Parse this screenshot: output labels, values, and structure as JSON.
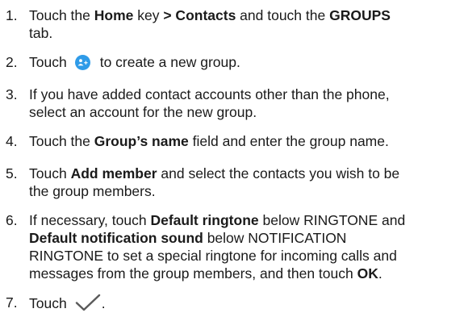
{
  "steps": [
    {
      "number": "1.",
      "lines": [
        {
          "parts": [
            {
              "t": "Touch the "
            },
            {
              "t": "Home",
              "b": true
            },
            {
              "t": " key "
            },
            {
              "t": "> Contacts",
              "b": true
            },
            {
              "t": " and touch the "
            },
            {
              "t": "GROUPS",
              "b": true
            }
          ]
        },
        {
          "parts": [
            {
              "t": "tab."
            }
          ]
        }
      ]
    },
    {
      "number": "2.",
      "lines": [
        {
          "parts": [
            {
              "t": "Touch"
            },
            {
              "icon": "add-group-icon"
            },
            {
              "t": "to create a new group."
            }
          ]
        }
      ]
    },
    {
      "number": "3.",
      "lines": [
        {
          "parts": [
            {
              "t": "If you have added contact accounts other than the phone,"
            }
          ]
        },
        {
          "parts": [
            {
              "t": "select an account for the new group."
            }
          ]
        }
      ]
    },
    {
      "number": "4.",
      "lines": [
        {
          "parts": [
            {
              "t": "Touch the "
            },
            {
              "t": "Group’s name",
              "b": true
            },
            {
              "t": " field and enter the group name."
            }
          ]
        }
      ]
    },
    {
      "number": "5.",
      "lines": [
        {
          "parts": [
            {
              "t": "Touch "
            },
            {
              "t": "Add member",
              "b": true
            },
            {
              "t": " and select the contacts you wish to be"
            }
          ]
        },
        {
          "parts": [
            {
              "t": "the group members."
            }
          ]
        }
      ]
    },
    {
      "number": "6.",
      "lines": [
        {
          "parts": [
            {
              "t": "If necessary, touch "
            },
            {
              "t": "Default ringtone",
              "b": true
            },
            {
              "t": " below RINGTONE and"
            }
          ]
        },
        {
          "parts": [
            {
              "t": "Default notification sound",
              "b": true
            },
            {
              "t": " below NOTIFICATION"
            }
          ]
        },
        {
          "parts": [
            {
              "t": "RINGTONE to set a special ringtone for incoming calls and"
            }
          ]
        },
        {
          "parts": [
            {
              "t": "messages from the group members, and then touch "
            },
            {
              "t": "OK",
              "b": true
            },
            {
              "t": "."
            }
          ]
        }
      ]
    },
    {
      "number": "7.",
      "lines": [
        {
          "parts": [
            {
              "t": "Touch"
            },
            {
              "icon": "checkmark-icon"
            },
            {
              "t": "."
            }
          ]
        }
      ]
    }
  ],
  "colors": {
    "text": "#1a1a1a",
    "icon_blue": "#2f9be8",
    "check_gray": "#5a5a5a"
  }
}
